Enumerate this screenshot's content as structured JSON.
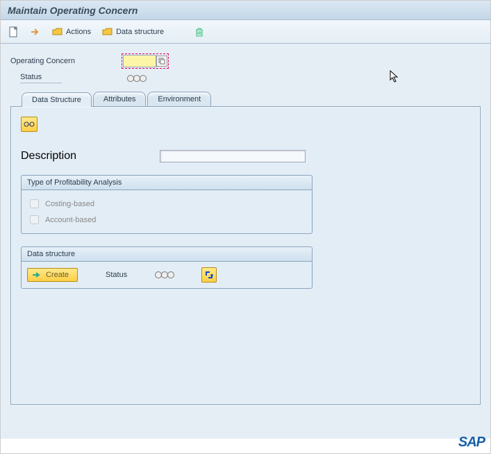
{
  "title": "Maintain Operating Concern",
  "toolbar": {
    "actions": "Actions",
    "data_structure": "Data structure"
  },
  "form": {
    "operating_concern_label": "Operating Concern",
    "operating_concern_value": "",
    "status_label": "Status"
  },
  "tabs": {
    "data_structure": "Data Structure",
    "attributes": "Attributes",
    "environment": "Environment"
  },
  "panel": {
    "description_label": "Description",
    "description_value": "",
    "type_groupbox_title": "Type of Profitability Analysis",
    "costing_based": "Costing-based",
    "account_based": "Account-based",
    "ds_groupbox_title": "Data structure",
    "create": "Create",
    "status_label": "Status"
  },
  "brand": "SAP"
}
